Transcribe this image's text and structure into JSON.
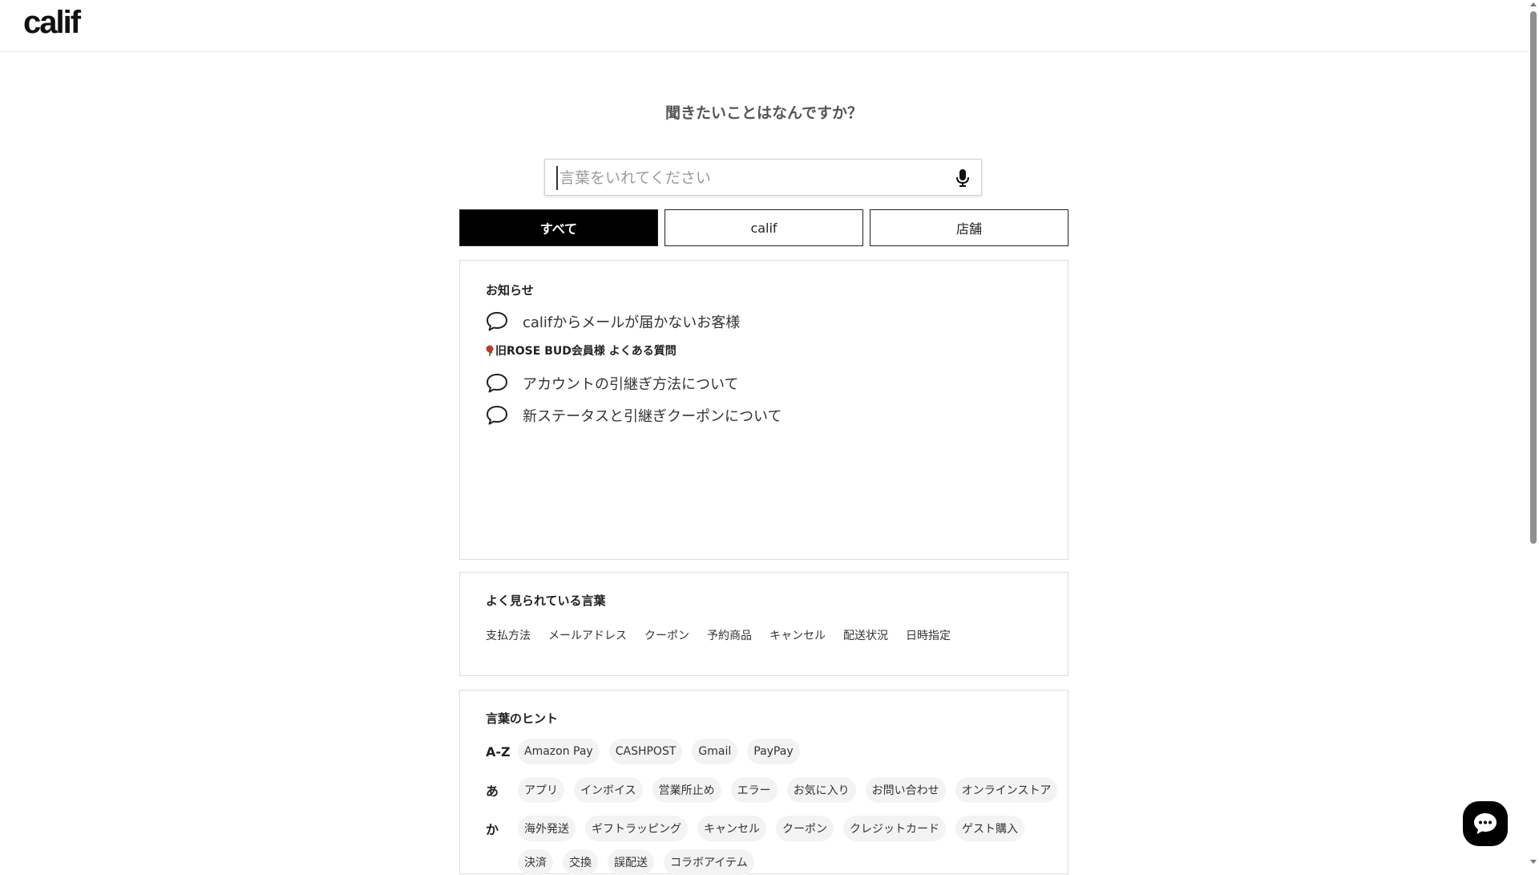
{
  "header": {
    "logo_text": "calif"
  },
  "main": {
    "question": "聞きたいことはなんですか？",
    "search": {
      "placeholder": "言葉をいれてください",
      "value": ""
    },
    "tabs": [
      {
        "label": "すべて",
        "active": true
      },
      {
        "label": "calif",
        "active": false
      },
      {
        "label": "店舗",
        "active": false
      }
    ]
  },
  "notices": {
    "title": "お知らせ",
    "items": [
      {
        "text": "califからメールが届かないお客様"
      }
    ],
    "subhead": "旧ROSE BUD会員様 よくある質問",
    "sub_items": [
      {
        "text": "アカウントの引継ぎ方法について"
      },
      {
        "text": "新ステータスと引継ぎクーポンについて"
      }
    ]
  },
  "popular": {
    "title": "よく見られている言葉",
    "words": [
      "支払方法",
      "メールアドレス",
      "クーポン",
      "予約商品",
      "キャンセル",
      "配送状況",
      "日時指定"
    ]
  },
  "hints": {
    "title": "言葉のヒント",
    "rows": [
      {
        "label": "A-Z",
        "chips": [
          "Amazon Pay",
          "CASHPOST",
          "Gmail",
          "PayPay"
        ]
      },
      {
        "label": "あ",
        "chips": [
          "アプリ",
          "インボイス",
          "営業所止め",
          "エラー",
          "お気に入り",
          "お問い合わせ",
          "オンラインストア"
        ]
      },
      {
        "label": "か",
        "chips": [
          "海外発送",
          "ギフトラッピング",
          "キャンセル",
          "クーポン",
          "クレジットカード",
          "ゲスト購入"
        ]
      },
      {
        "label": "",
        "chips": [
          "決済",
          "交換",
          "誤配送",
          "コラボアイテム"
        ]
      }
    ]
  },
  "colors": {
    "active_tab_bg": "#000000",
    "border": "#dddddd",
    "chip_bg": "#f3f3f3",
    "chat_button_bg": "#000000"
  },
  "icons": {
    "mic": "microphone-icon",
    "bubble": "speech-bubble-icon",
    "rose": "rose-icon",
    "chat": "chat-icon"
  }
}
